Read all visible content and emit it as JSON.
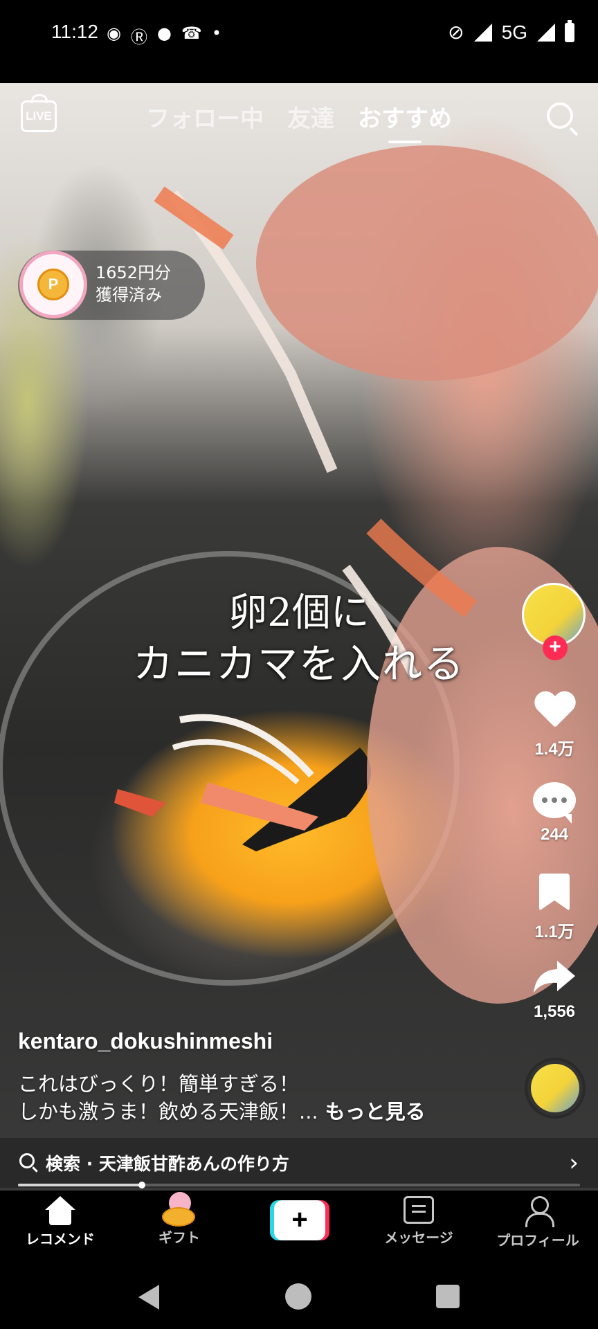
{
  "status_bar": {
    "time": "11:12",
    "left_icons": [
      "messenger-icon",
      "rakuten-link-icon",
      "chat-icon",
      "phone-icon",
      "dot-icon"
    ],
    "network": "5G",
    "right_icons": [
      "mute-icon",
      "signal-icon",
      "signal-icon",
      "battery-icon"
    ]
  },
  "top_nav": {
    "live_label": "LIVE",
    "tabs": [
      {
        "label": "フォロー中",
        "active": false
      },
      {
        "label": "友達",
        "active": false
      },
      {
        "label": "おすすめ",
        "active": true
      }
    ]
  },
  "reward": {
    "line1": "1652円分",
    "line2": "獲得済み",
    "coin_letter": "P"
  },
  "video_overlay": {
    "line1": "卵2個に",
    "line2": "カニカマを入れる"
  },
  "actions": {
    "follow_badge": "+",
    "likes": "1.4万",
    "comments": "244",
    "saves": "1.1万",
    "shares": "1,556"
  },
  "caption": {
    "username": "kentaro_dokushinmeshi",
    "line1": "これはびっくり！簡単すぎる！",
    "line2": "しかも激うま！飲める天津飯！...",
    "more": "もっと見る"
  },
  "search_suggestion": {
    "text": "検索 · 天津飯甘酢あんの作り方",
    "chevron": "›"
  },
  "progress": {
    "fraction": 0.22
  },
  "bottom_nav": {
    "items": [
      {
        "label": "レコメンド",
        "icon": "home-icon",
        "active": true
      },
      {
        "label": "ギフト",
        "icon": "gift-icon",
        "active": false
      },
      {
        "label": "",
        "icon": "plus-icon",
        "active": false
      },
      {
        "label": "メッセージ",
        "icon": "message-icon",
        "active": false
      },
      {
        "label": "プロフィール",
        "icon": "profile-icon",
        "active": false
      }
    ],
    "plus_label": "+"
  },
  "colors": {
    "accent_red": "#fe2c55",
    "accent_cyan": "#2bd6e6",
    "reward_ring": "#f3a6c0"
  }
}
